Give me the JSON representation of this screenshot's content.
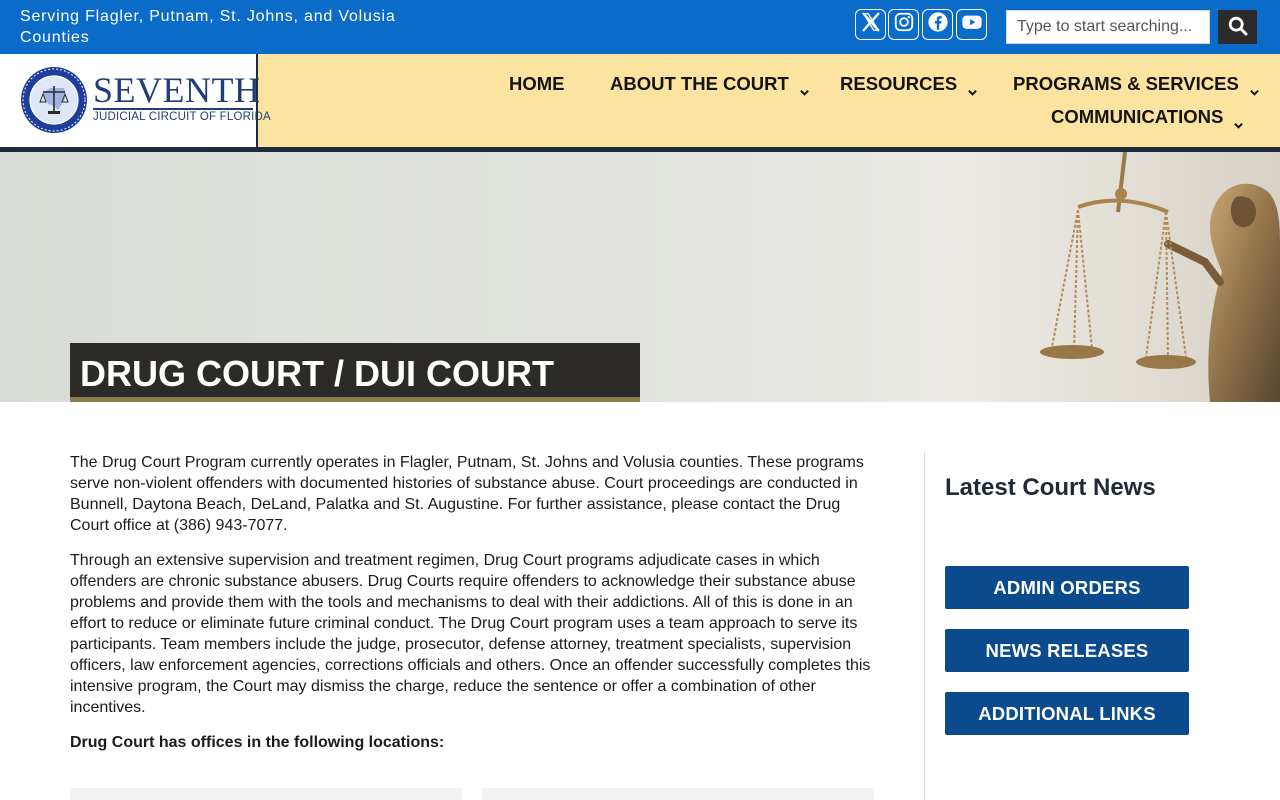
{
  "topbar": {
    "tagline": "Serving Flagler, Putnam, St. Johns, and Volusia Counties",
    "social": [
      {
        "icon": "x-icon"
      },
      {
        "icon": "instagram-icon"
      },
      {
        "icon": "facebook-icon"
      },
      {
        "icon": "youtube-icon"
      }
    ],
    "search": {
      "placeholder": "Type to start searching...",
      "value": ""
    },
    "colors": {
      "bar": "#0b6bc8",
      "search_button": "#2b2b2b"
    }
  },
  "header": {
    "logo": {
      "word": "SEVENTH",
      "subtitle": "JUDICIAL CIRCUIT OF FLORIDA"
    },
    "nav": [
      {
        "label": "HOME",
        "has_dropdown": false
      },
      {
        "label": "ABOUT THE COURT",
        "has_dropdown": true
      },
      {
        "label": "RESOURCES",
        "has_dropdown": true
      },
      {
        "label": "PROGRAMS & SERVICES",
        "has_dropdown": true
      },
      {
        "label": "COMMUNICATIONS",
        "has_dropdown": true
      }
    ],
    "colors": {
      "background": "#fde3a0",
      "border": "#1e2b3a"
    }
  },
  "hero": {
    "title": "DRUG COURT / DUI COURT",
    "colors": {
      "title_box": "#2d2b27",
      "title_underline": "#8a7d4f"
    }
  },
  "main": {
    "paragraphs": [
      "The Drug Court Program currently operates in Flagler, Putnam, St. Johns and Volusia counties. These programs serve non-violent offenders with documented histories of substance abuse. Court proceedings are conducted in Bunnell, Daytona Beach, DeLand, Palatka and St. Augustine. For further assistance, please contact the Drug Court office at (386) 943-7077.",
      "Through an extensive supervision and treatment regimen, Drug Court programs adjudicate cases in which offenders are chronic substance abusers. Drug Courts require offenders to acknowledge their substance abuse problems and provide them with the tools and mechanisms to deal with their addictions. All of this is done in an effort to reduce or eliminate future criminal conduct. The Drug Court program uses a team approach to serve its participants. Team members include the judge, prosecutor, defense attorney, treatment specialists, supervision officers, law enforcement agencies, corrections officials and others. Once an offender successfully completes this intensive program, the Court may dismiss the charge, reduce the sentence or offer a combination of other incentives."
    ],
    "locations_heading": "Drug Court has offices in the following locations:"
  },
  "sidebar": {
    "title": "Latest Court News",
    "buttons": [
      {
        "label": "ADMIN ORDERS"
      },
      {
        "label": "NEWS RELEASES"
      },
      {
        "label": "ADDITIONAL LINKS"
      }
    ],
    "colors": {
      "button": "#0b4a8c"
    }
  }
}
